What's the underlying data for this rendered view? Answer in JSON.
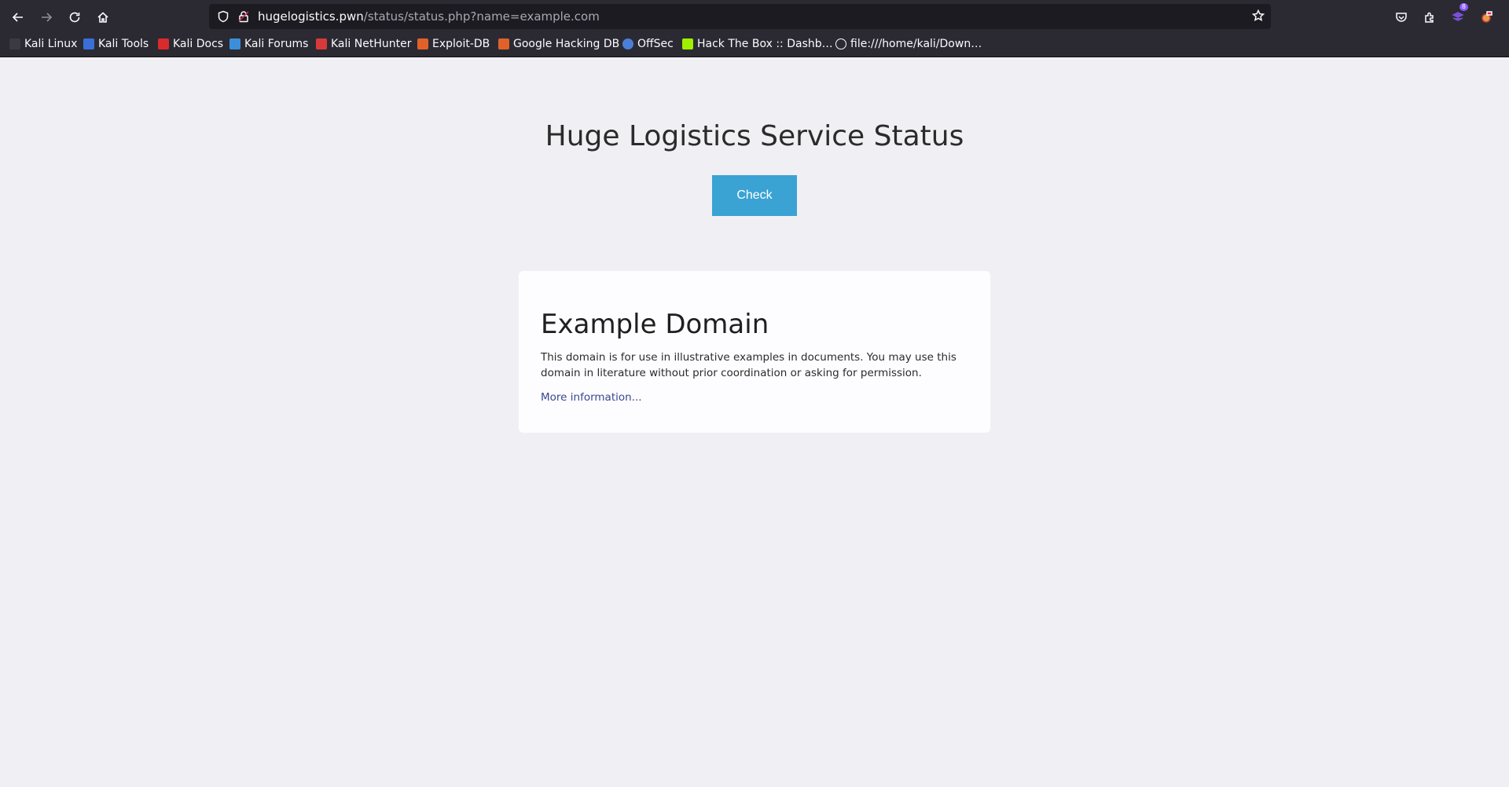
{
  "browser": {
    "url_host": "hugelogistics.pwn",
    "url_path": "/status/status.php?name=example.com",
    "extensions_badge": "8",
    "bookmarks": [
      {
        "label": "Kali Linux",
        "icon": "kali-dragon-icon",
        "color": "#1c1b22"
      },
      {
        "label": "Kali Tools",
        "icon": "kali-tools-icon",
        "color": "#3b6fd8"
      },
      {
        "label": "Kali Docs",
        "icon": "kali-docs-icon",
        "color": "#d92b2b"
      },
      {
        "label": "Kali Forums",
        "icon": "kali-forums-icon",
        "color": "#3a8fd8"
      },
      {
        "label": "Kali NetHunter",
        "icon": "kali-nethunter-icon",
        "color": "#d83a3a"
      },
      {
        "label": "Exploit-DB",
        "icon": "exploit-db-icon",
        "color": "#e0622a"
      },
      {
        "label": "Google Hacking DB",
        "icon": "ghdb-icon",
        "color": "#e0622a"
      },
      {
        "label": "OffSec",
        "icon": "offsec-icon",
        "color": "#4a7fd8"
      },
      {
        "label": "Hack The Box :: Dashb…",
        "icon": "htb-cube-icon",
        "color": "#9fef00"
      },
      {
        "label": "file:///home/kali/Down…",
        "icon": "globe-icon",
        "color": "#fbfbfe"
      }
    ]
  },
  "page": {
    "title": "Huge Logistics Service Status",
    "check_label": "Check",
    "card": {
      "heading": "Example Domain",
      "body": "This domain is for use in illustrative examples in documents. You may use this domain in literature without prior coordination or asking for permission.",
      "link": "More information..."
    }
  },
  "colors": {
    "accent_button": "#3aa3d4",
    "chrome_bg": "#2b2a33",
    "page_bg": "#f0f0f4"
  }
}
